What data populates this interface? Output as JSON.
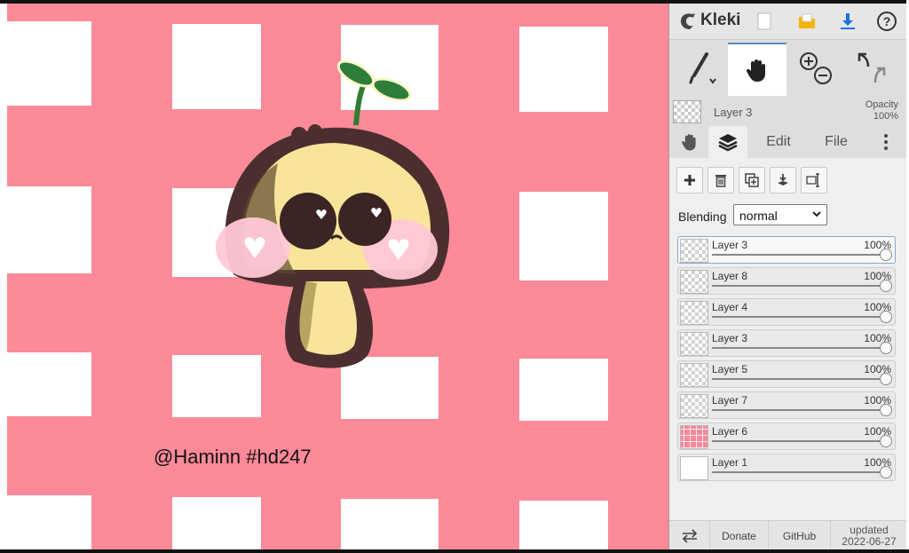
{
  "app": {
    "name": "Kleki"
  },
  "topbar": {
    "icons": [
      "kleki-logo-icon",
      "new-file-icon",
      "save-icon",
      "download-icon",
      "help-icon"
    ]
  },
  "tools": [
    "brush-tool",
    "hand-tool",
    "zoom-in-icon",
    "zoom-out-icon",
    "undo-icon",
    "redo-icon"
  ],
  "current_layer": {
    "name": "Layer 3",
    "opacity_label": "Opacity",
    "opacity_value": "100%"
  },
  "tabs": {
    "edit": "Edit",
    "file": "File"
  },
  "blending": {
    "label": "Blending",
    "value": "normal"
  },
  "layers": [
    {
      "name": "Layer 3",
      "opacity": "100%",
      "selected": true
    },
    {
      "name": "Layer 8",
      "opacity": "100%"
    },
    {
      "name": "Layer 4",
      "opacity": "100%"
    },
    {
      "name": "Layer 3",
      "opacity": "100%"
    },
    {
      "name": "Layer 5",
      "opacity": "100%"
    },
    {
      "name": "Layer 7",
      "opacity": "100%"
    },
    {
      "name": "Layer 6",
      "opacity": "100%"
    },
    {
      "name": "Layer 1",
      "opacity": "100%"
    }
  ],
  "footer": {
    "donate": "Donate",
    "github": "GitHub",
    "updated_label": "updated",
    "updated_date": "2022-06-27"
  },
  "canvas": {
    "signature": "@Haminn #hd247",
    "bg_color": "#fd8a98"
  }
}
